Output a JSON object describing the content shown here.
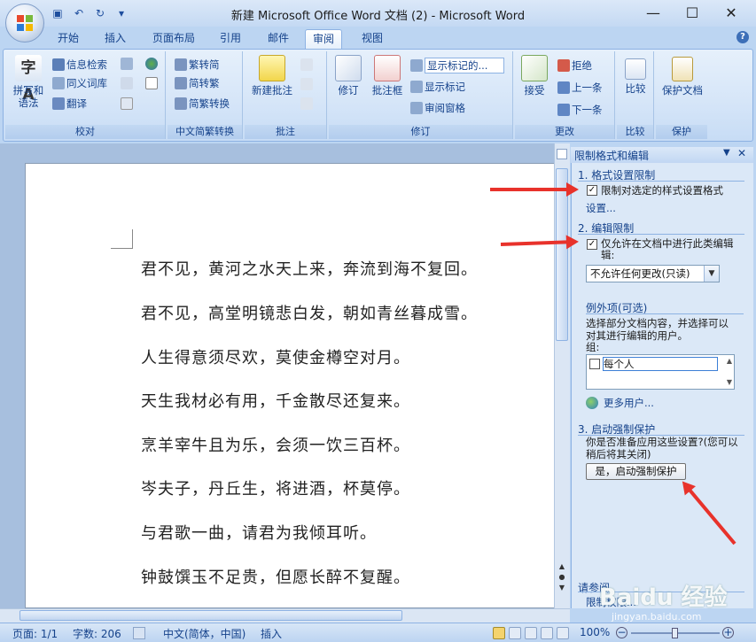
{
  "window": {
    "title": "新建 Microsoft Office Word 文档 (2) - Microsoft Word",
    "minimize": "—",
    "maximize": "☐",
    "close": "✕"
  },
  "qat": {
    "save": "▣",
    "undo": "↶",
    "redo": "↻",
    "more": "▾"
  },
  "tabs": [
    "开始",
    "插入",
    "页面布局",
    "引用",
    "邮件",
    "审阅",
    "视图"
  ],
  "active_tab": "审阅",
  "ribbon": {
    "proofing": {
      "label": "校对",
      "spelling": "拼写和\n语法",
      "research": "信息检索",
      "thesaurus": "同义词库",
      "translate": "翻译"
    },
    "chinese": {
      "label": "中文简繁转换",
      "to_trad": "繁转简",
      "to_simp": "简转繁",
      "convert": "简繁转换"
    },
    "comments": {
      "label": "批注",
      "new_comment": "新建批注"
    },
    "tracking": {
      "label": "修订",
      "track_changes": "修订",
      "balloons": "批注框",
      "markup_combo": "显示标记的...",
      "show_markup": "显示标记",
      "review_pane": "审阅窗格"
    },
    "changes": {
      "label": "更改",
      "accept": "接受",
      "reject": "拒绝",
      "previous": "上一条",
      "next": "下一条"
    },
    "compare": {
      "label": "比较",
      "compare": "比较"
    },
    "protect": {
      "label": "保护",
      "protect_doc": "保护文档"
    }
  },
  "document": {
    "lines": [
      "君不见，黄河之水天上来，奔流到海不复回。",
      "君不见，高堂明镜悲白发，朝如青丝暮成雪。",
      "人生得意须尽欢，莫使金樽空对月。",
      "天生我材必有用，千金散尽还复来。",
      "烹羊宰牛且为乐，会须一饮三百杯。",
      "岑夫子，丹丘生，将进酒，杯莫停。",
      "与君歌一曲，请君为我倾耳听。",
      "钟鼓馔玉不足贵，但愿长醉不复醒。"
    ]
  },
  "pane": {
    "title": "限制格式和编辑",
    "sec1": "1. 格式设置限制",
    "sec1_check": "限制对选定的样式设置格式",
    "sec1_checked": true,
    "sec1_link": "设置...",
    "sec2": "2. 编辑限制",
    "sec2_check": "仅允许在文档中进行此类编辑",
    "sec2_check2": "辑:",
    "sec2_checked": true,
    "edit_type": "不允许任何更改(只读)",
    "exceptions_title": "例外项(可选)",
    "exceptions_desc": "选择部分文档内容，并选择可以对其进行编辑的用户。",
    "groups_label": "组:",
    "group_everyone": "每个人",
    "more_users": "更多用户...",
    "sec3": "3. 启动强制保护",
    "sec3_desc": "你是否准备应用这些设置?(您可以稍后将其关闭)",
    "enforce_button": "是，启动强制保护",
    "see_also": "请参阅",
    "restrict_permission": "限制权限..."
  },
  "status": {
    "page": "页面: 1/1",
    "words": "字数: 206",
    "language": "中文(简体，中国)",
    "insert": "插入",
    "zoom": "100%"
  },
  "watermark": {
    "brand": "Baidu 经验",
    "url": "jingyan.baidu.com"
  },
  "colors": {
    "accent": "#15428b",
    "arrow": "#e8322b",
    "ribbon": "#d5e5f8"
  }
}
